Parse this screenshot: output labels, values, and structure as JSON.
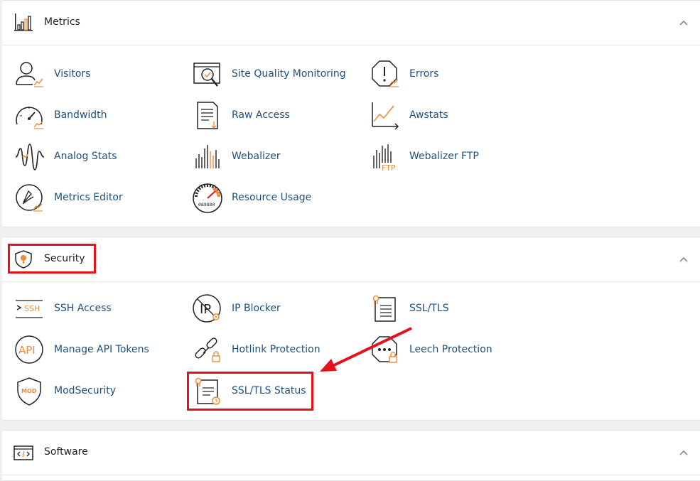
{
  "colors": {
    "accent": "#f08a3c",
    "link": "#1f4f7b",
    "highlight": "#e5121c"
  },
  "metrics": {
    "title": "Metrics",
    "icon": "bar-chart-icon",
    "items": [
      {
        "label": "Visitors",
        "icon": "visitors-icon"
      },
      {
        "label": "Site Quality Monitoring",
        "icon": "site-quality-icon"
      },
      {
        "label": "Errors",
        "icon": "errors-icon"
      },
      {
        "label": "Bandwidth",
        "icon": "bandwidth-gauge-icon"
      },
      {
        "label": "Raw Access",
        "icon": "raw-access-document-icon"
      },
      {
        "label": "Awstats",
        "icon": "awstats-line-chart-icon"
      },
      {
        "label": "Analog Stats",
        "icon": "analog-waveform-icon"
      },
      {
        "label": "Webalizer",
        "icon": "webalizer-bars-icon"
      },
      {
        "label": "Webalizer FTP",
        "icon": "webalizer-ftp-icon",
        "icon_text": "FTP"
      },
      {
        "label": "Metrics Editor",
        "icon": "metrics-editor-icon"
      },
      {
        "label": "Resource Usage",
        "icon": "resource-usage-gauge-icon",
        "icon_text": "088880"
      }
    ]
  },
  "security": {
    "title": "Security",
    "icon": "shield-icon",
    "items": [
      {
        "label": "SSH Access",
        "icon": "ssh-terminal-icon",
        "icon_text": "SSH"
      },
      {
        "label": "IP Blocker",
        "icon": "ip-blocker-icon",
        "icon_text": "IP"
      },
      {
        "label": "SSL/TLS",
        "icon": "ssl-certificate-icon"
      },
      {
        "label": "Manage API Tokens",
        "icon": "api-tokens-icon",
        "icon_text": "API"
      },
      {
        "label": "Hotlink Protection",
        "icon": "hotlink-chain-icon"
      },
      {
        "label": "Leech Protection",
        "icon": "leech-protection-icon"
      },
      {
        "label": "ModSecurity",
        "icon": "modsecurity-shield-icon",
        "icon_text": "MOD"
      },
      {
        "label": "SSL/TLS Status",
        "icon": "ssl-status-icon"
      }
    ]
  },
  "software": {
    "title": "Software",
    "icon": "code-window-icon"
  }
}
